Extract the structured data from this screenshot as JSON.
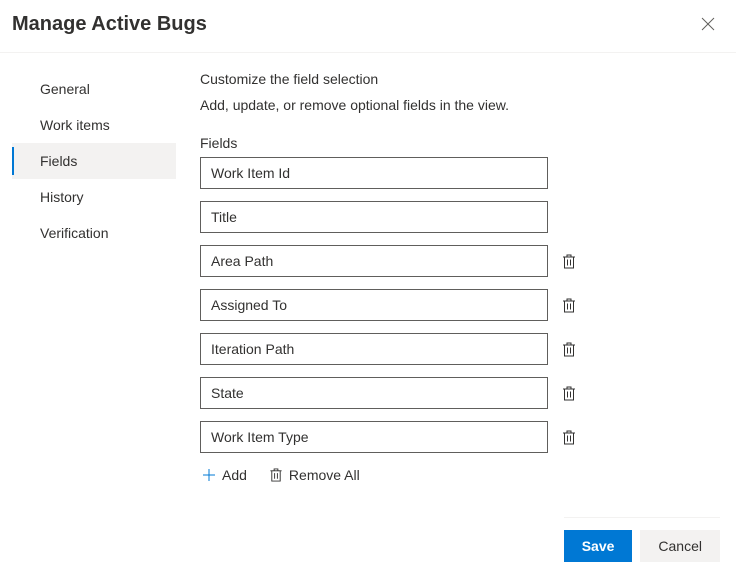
{
  "header": {
    "title": "Manage Active Bugs"
  },
  "sidebar": {
    "items": [
      {
        "label": "General",
        "selected": false
      },
      {
        "label": "Work items",
        "selected": false
      },
      {
        "label": "Fields",
        "selected": true
      },
      {
        "label": "History",
        "selected": false
      },
      {
        "label": "Verification",
        "selected": false
      }
    ]
  },
  "main": {
    "section_title": "Customize the field selection",
    "section_subtitle": "Add, update, or remove optional fields in the view.",
    "fields_label": "Fields",
    "fields": [
      {
        "value": "Work Item Id",
        "deletable": false
      },
      {
        "value": "Title",
        "deletable": false
      },
      {
        "value": "Area Path",
        "deletable": true
      },
      {
        "value": "Assigned To",
        "deletable": true
      },
      {
        "value": "Iteration Path",
        "deletable": true
      },
      {
        "value": "State",
        "deletable": true
      },
      {
        "value": "Work Item Type",
        "deletable": true
      }
    ],
    "add_label": "Add",
    "remove_all_label": "Remove All"
  },
  "footer": {
    "save_label": "Save",
    "cancel_label": "Cancel"
  }
}
